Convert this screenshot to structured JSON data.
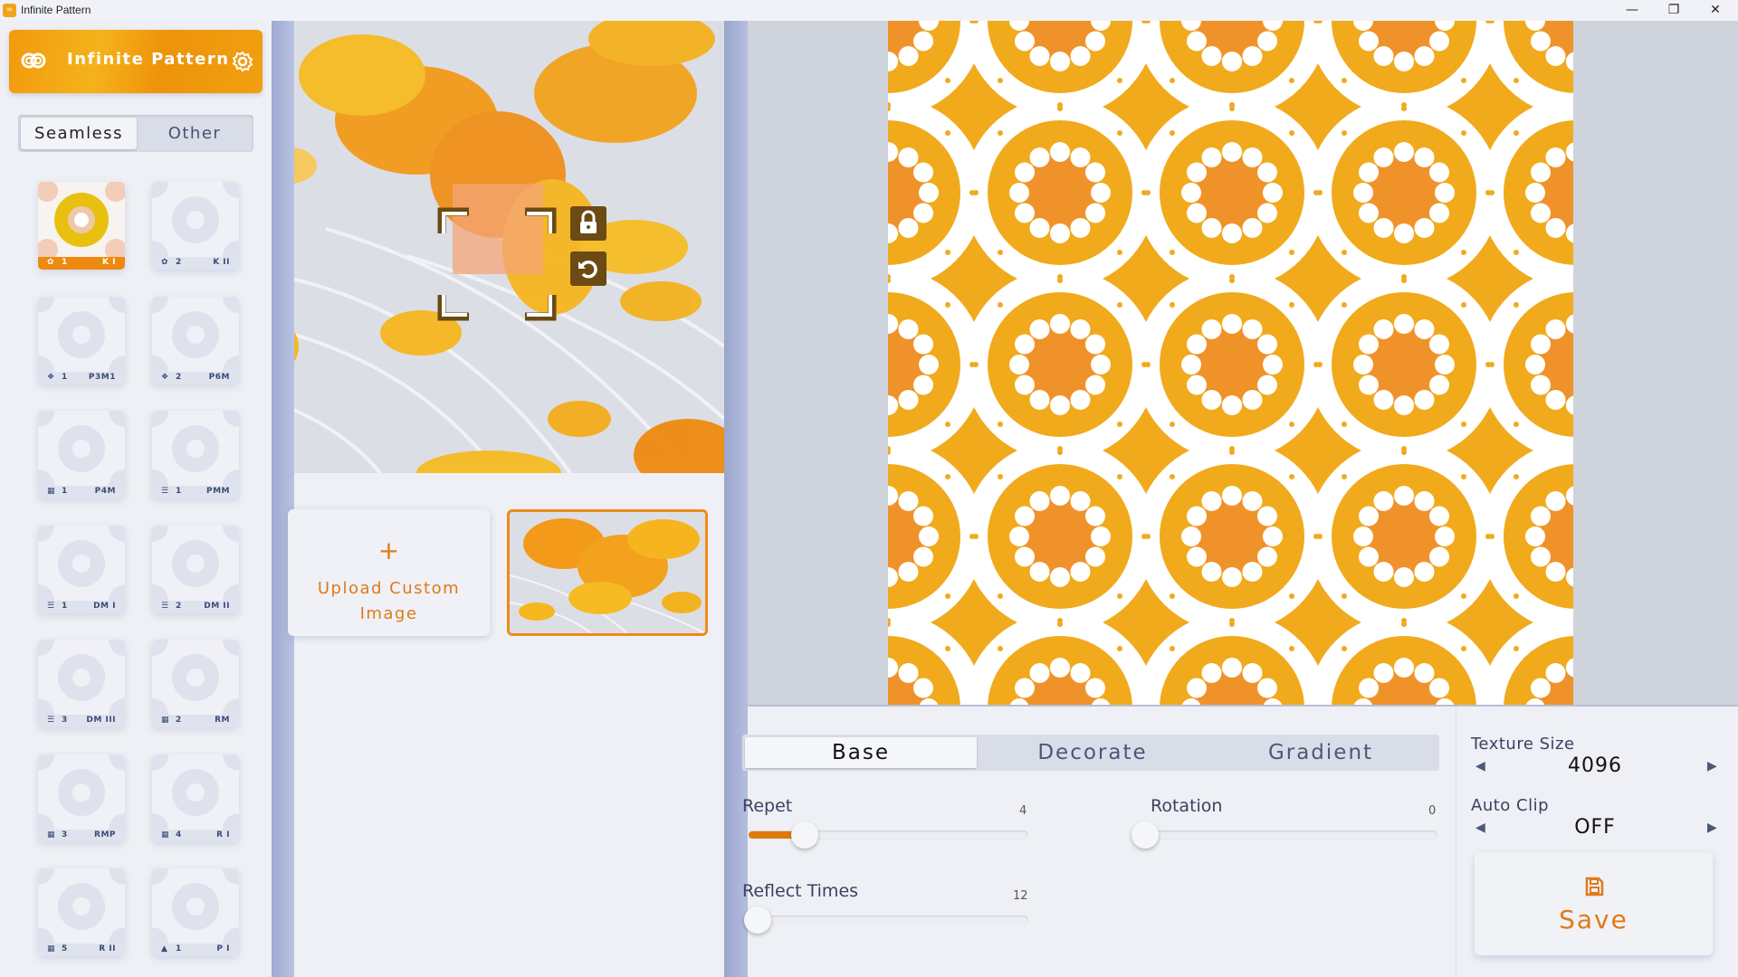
{
  "window": {
    "title": "Infinite Pattern",
    "app_icon": "infinity-logo-icon",
    "controls": [
      "minimize",
      "restore",
      "close"
    ]
  },
  "sidebar": {
    "banner_title": "Infinite Pattern",
    "tabs": [
      {
        "label": "Seamless",
        "active": true
      },
      {
        "label": "Other",
        "active": false
      }
    ],
    "patterns": [
      {
        "icon": "kaleido",
        "count": "1",
        "code": "K I",
        "selected": true
      },
      {
        "icon": "kaleido",
        "count": "2",
        "code": "K II"
      },
      {
        "icon": "hex",
        "count": "1",
        "code": "P3M1"
      },
      {
        "icon": "hex",
        "count": "2",
        "code": "P6M"
      },
      {
        "icon": "grid",
        "count": "1",
        "code": "P4M"
      },
      {
        "icon": "bars",
        "count": "1",
        "code": "PMM"
      },
      {
        "icon": "bars",
        "count": "1",
        "code": "DM I"
      },
      {
        "icon": "bars",
        "count": "2",
        "code": "DM II"
      },
      {
        "icon": "bars",
        "count": "3",
        "code": "DM III"
      },
      {
        "icon": "grid",
        "count": "2",
        "code": "RM"
      },
      {
        "icon": "grid",
        "count": "3",
        "code": "RMP"
      },
      {
        "icon": "grid",
        "count": "4",
        "code": "R I"
      },
      {
        "icon": "grid",
        "count": "5",
        "code": "R II"
      },
      {
        "icon": "triangle",
        "count": "1",
        "code": "P I"
      }
    ]
  },
  "source": {
    "upload_plus": "+",
    "upload_label": "Upload Custom Image"
  },
  "controls": {
    "tabs": [
      {
        "label": "Base",
        "active": true
      },
      {
        "label": "Decorate"
      },
      {
        "label": "Gradient"
      }
    ],
    "repet": {
      "label": "Repet",
      "value": "4",
      "fraction": 0.2
    },
    "rotation": {
      "label": "Rotation",
      "value": "0",
      "fraction": 0
    },
    "reflect": {
      "label": "Reflect Times",
      "value": "12",
      "fraction": 0
    }
  },
  "settings": {
    "texture_size_label": "Texture Size",
    "texture_size": "4096",
    "auto_clip_label": "Auto Clip",
    "auto_clip": "OFF",
    "save_label": "Save"
  },
  "colors": {
    "accent": "#ee8a10",
    "pattern_bg": "#f1aa1c",
    "pattern_center": "#f0922a",
    "pattern_white": "#ffffff"
  }
}
